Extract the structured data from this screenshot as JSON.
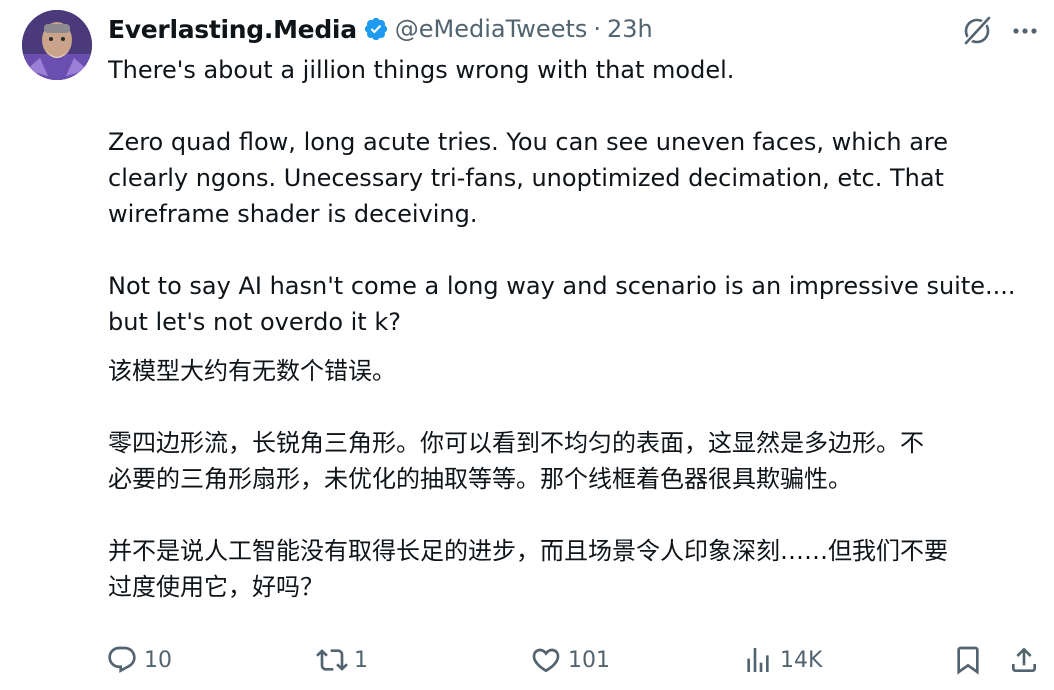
{
  "author": {
    "display_name": "Everlasting.Media",
    "handle": "@eMediaTweets",
    "separator": "·",
    "time": "23h",
    "verified_icon": "verified-badge-icon",
    "brand_color": "#1d9bf0"
  },
  "tweet": {
    "paragraphs": [
      [
        "There's about a jillion things wrong with that model."
      ],
      [
        "Zero quad flow, long acute tries. You can see uneven faces, which are",
        "clearly ngons. Unecessary tri-fans, unoptimized decimation, etc. That",
        "wireframe shader is deceiving."
      ],
      [
        "Not to say AI hasn't come a long way and scenario is an impressive suite....",
        "but let's not overdo it k?"
      ]
    ]
  },
  "translation": {
    "paragraphs": [
      [
        "该模型大约有无数个错误。"
      ],
      [
        "零四边形流，长锐角三角形。你可以看到不均匀的表面，这显然是多边形。不",
        "必要的三角形扇形，未优化的抽取等等。那个线框着色器很具欺骗性。"
      ],
      [
        "并不是说人工智能没有取得长足的进步，而且场景令人印象深刻……但我们不要",
        "过度使用它，好吗？"
      ]
    ]
  },
  "actions": {
    "reply_count": "10",
    "retweet_count": "1",
    "like_count": "101",
    "views_count": "14K"
  },
  "icons": {
    "grok": "grok-icon",
    "more": "more-icon",
    "reply": "reply-icon",
    "retweet": "retweet-icon",
    "like": "heart-icon",
    "views": "views-chart-icon",
    "bookmark": "bookmark-icon",
    "share": "share-icon"
  },
  "colors": {
    "text": "#0f1419",
    "secondary": "#536471"
  }
}
